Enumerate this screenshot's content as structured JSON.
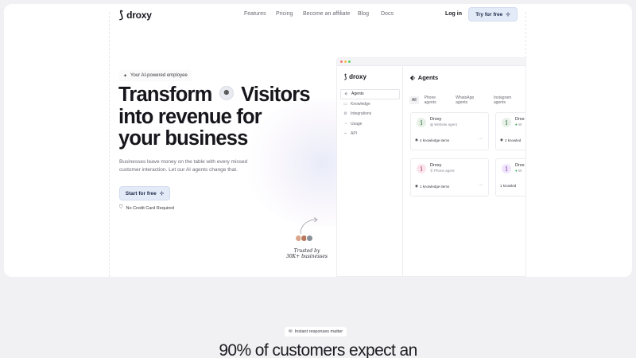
{
  "nav": {
    "brand": "droxy",
    "links": [
      "Features",
      "Pricing",
      "Become an affiliate",
      "Blog",
      "Docs"
    ],
    "login": "Log in",
    "cta": "Try for free",
    "cta_icon": "cursor-icon"
  },
  "hero": {
    "badge": "Your AI-powered employee",
    "title_part1": "Transform",
    "title_part2": "Visitors",
    "title_line2": "into revenue for",
    "title_line3": "your business",
    "description": "Businesses leave money on the table with every missed customer interaction. Let our AI agents change that.",
    "cta": "Start for free",
    "no_card": "No Credit Card Required",
    "trusted_line1": "Trusted by",
    "trusted_line2": "30K+ businesses"
  },
  "app": {
    "brand": "droxy",
    "sidebar": [
      {
        "label": "Agents",
        "icon": "agents-icon",
        "active": true
      },
      {
        "label": "Knowledge",
        "icon": "knowledge-icon",
        "active": false
      },
      {
        "label": "Integrations",
        "icon": "integrations-icon",
        "active": false
      },
      {
        "label": "Usage",
        "icon": "usage-icon",
        "active": false
      },
      {
        "label": "API",
        "icon": "api-icon",
        "active": false
      }
    ],
    "title": "Agents",
    "filters": [
      "All",
      "Phone agents",
      "WhatsApp agents",
      "Instagram agents"
    ],
    "cards": [
      {
        "name": "Droxy",
        "sub": "Website agent",
        "foot": "4 knowledge items",
        "color": "#e6f0e6",
        "ink": "#2c6b3a"
      },
      {
        "name": "Drox",
        "sub": "W",
        "foot": "2 knowled",
        "color": "#e8f1e8",
        "ink": "#2c6b3a"
      },
      {
        "name": "Droxy",
        "sub": "Phone agent",
        "foot": "1 knowledge items",
        "color": "#fbe4ec",
        "ink": "#b0385e"
      },
      {
        "name": "Drox",
        "sub": "W",
        "foot": "1 knowled",
        "color": "#efe4fb",
        "ink": "#7a3db0"
      }
    ]
  },
  "section2": {
    "badge": "Instant responses matter",
    "title": "90% of customers expect an"
  },
  "colors": {
    "accent_bg": "#e4ebf8",
    "brand_ink": "#16161c"
  }
}
